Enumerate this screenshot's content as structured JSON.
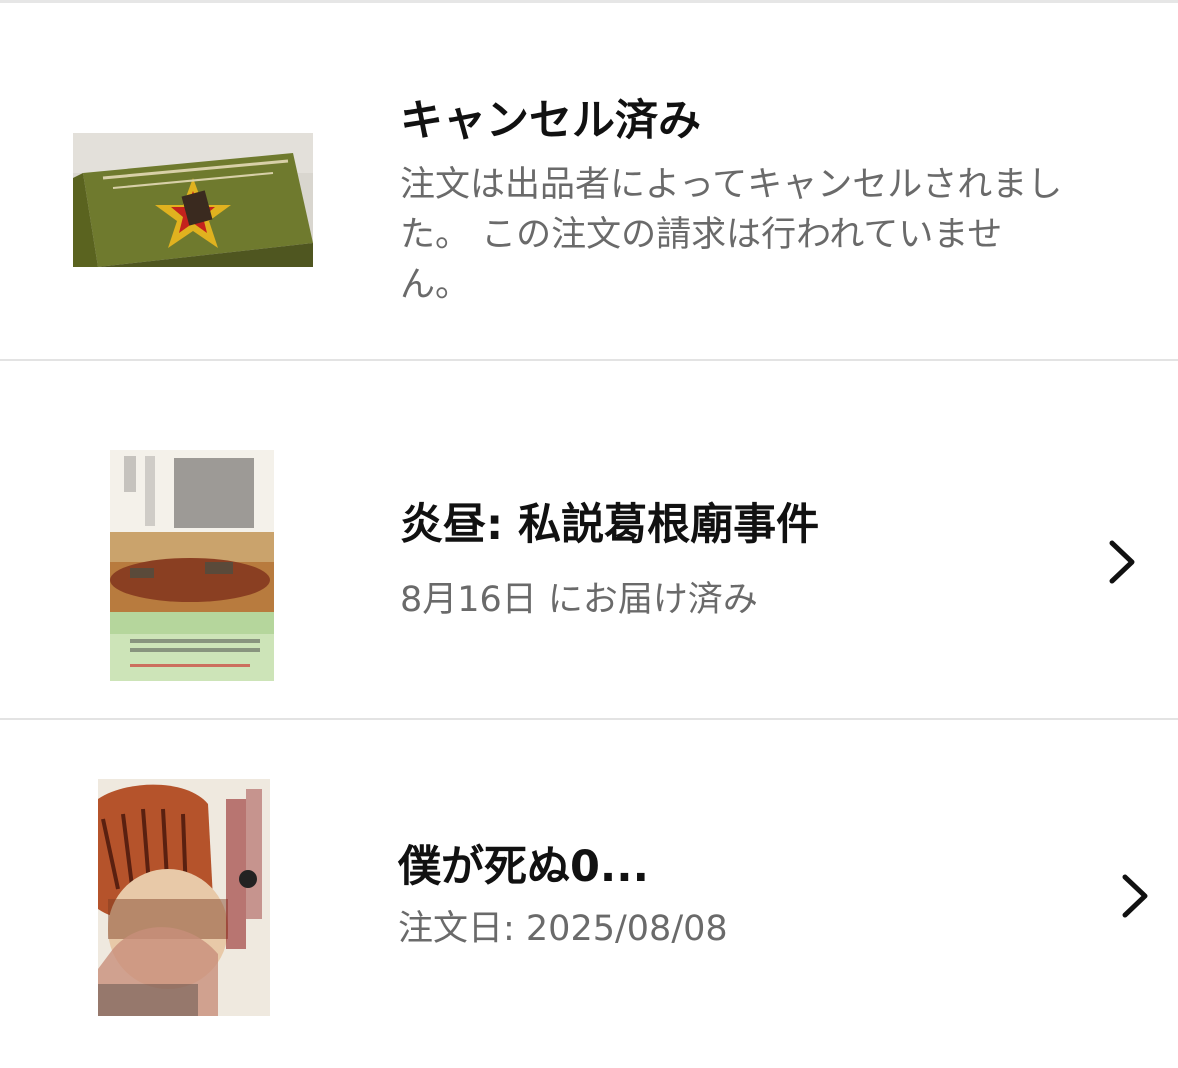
{
  "orders": [
    {
      "status_title": "キャンセル済み",
      "message": "注文は出品者によってキャンセルされました。 この注文の請求は行われていません。",
      "has_chevron": false
    },
    {
      "title": "炎昼: 私説葛根廟事件",
      "subtitle": "8月16日 にお届け済み",
      "has_chevron": true
    },
    {
      "title": "僕が死ぬ0...",
      "subtitle": "注文日: 2025/08/08",
      "has_chevron": true
    }
  ],
  "colors": {
    "title_text": "#111111",
    "secondary_text": "#6a6a6a",
    "divider": "#e3e3e3",
    "background": "#ffffff"
  },
  "icons": {
    "chevron": "chevron-right-icon"
  }
}
